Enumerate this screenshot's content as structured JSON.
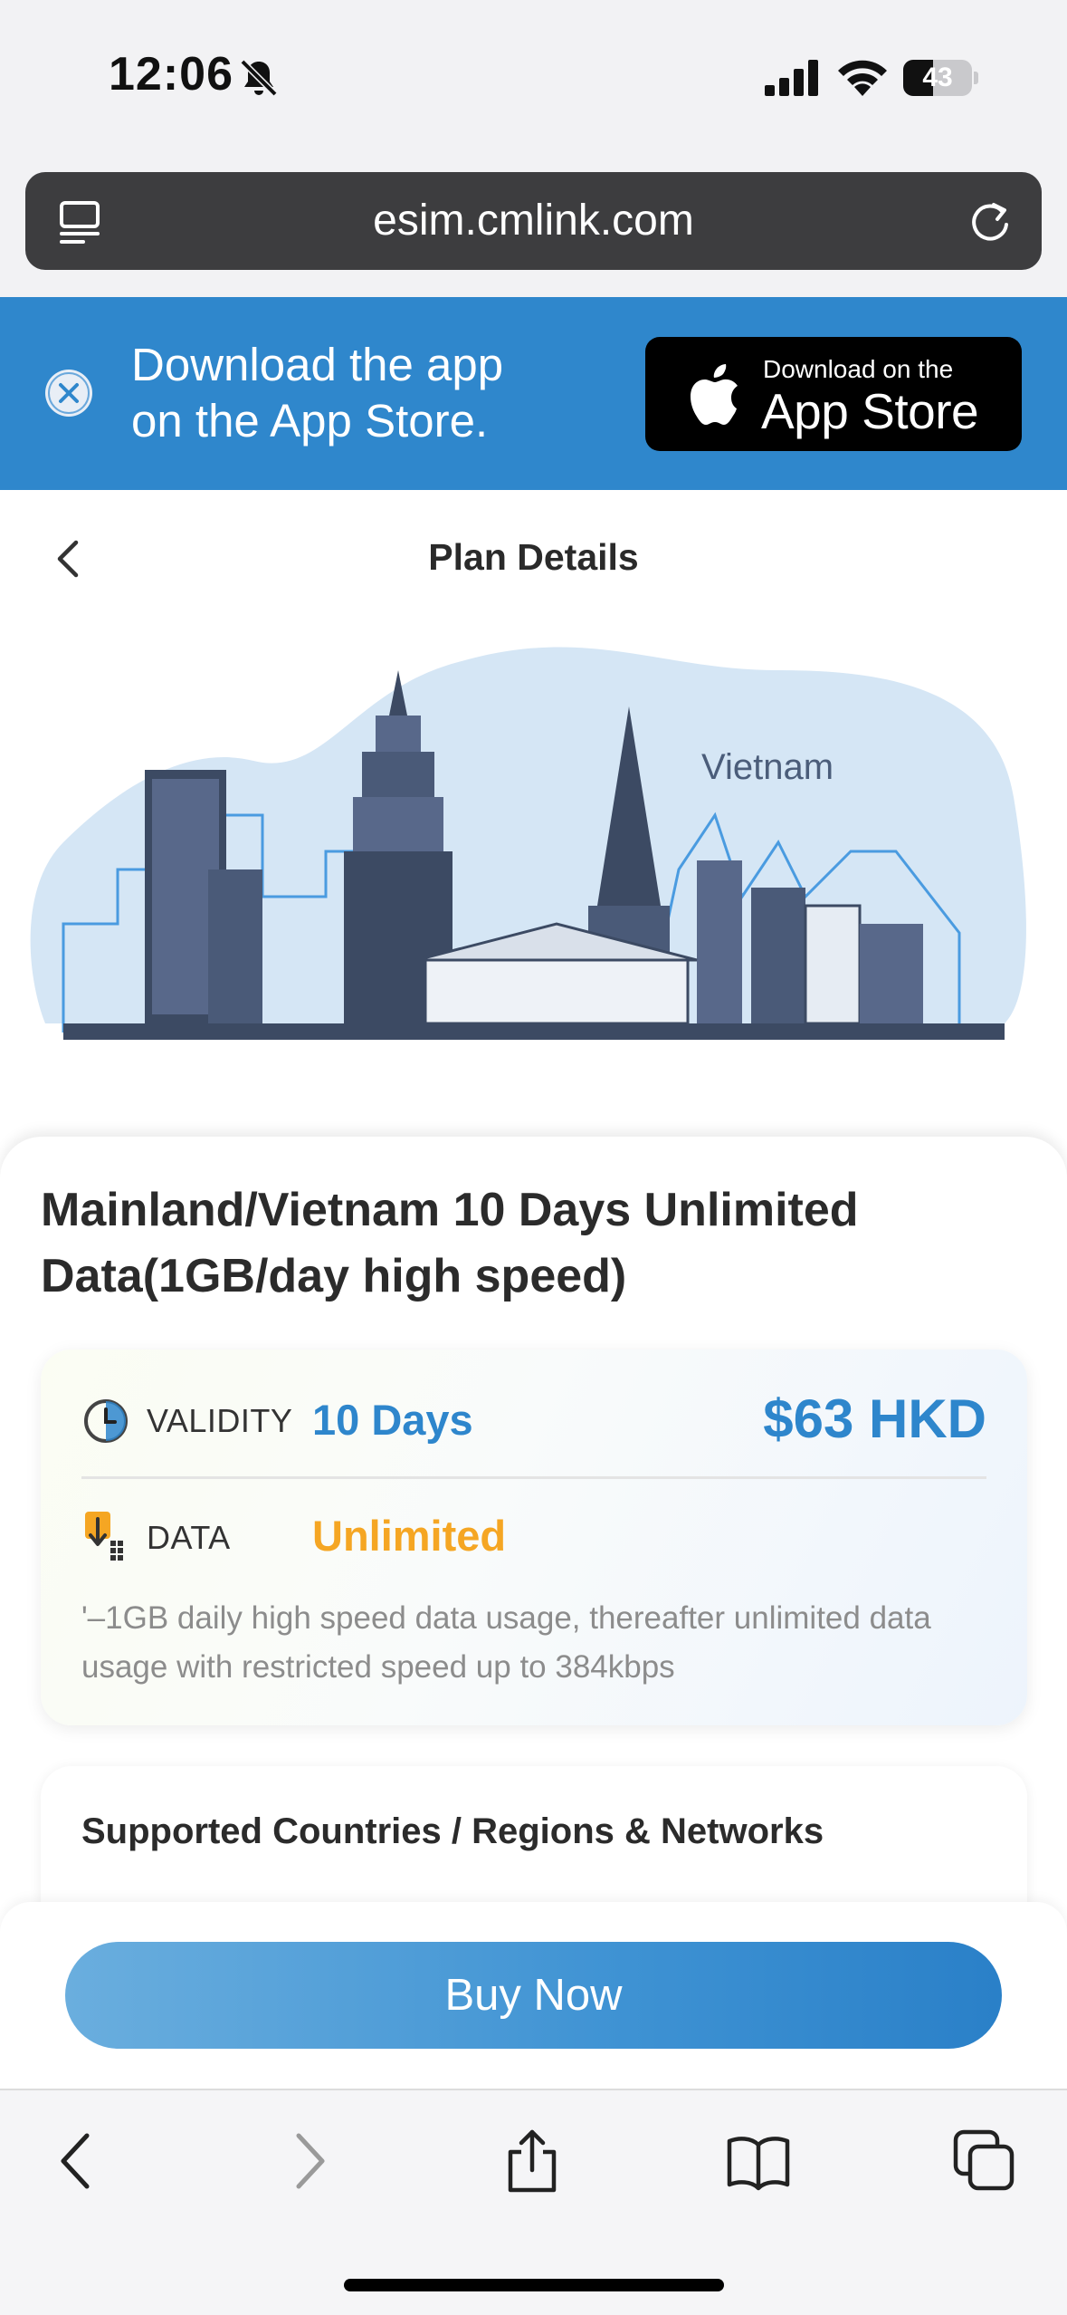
{
  "status_bar": {
    "time": "12:06",
    "battery_level": "43",
    "icons": [
      "bell-off-icon",
      "cellular-signal-icon",
      "wifi-icon",
      "battery-icon"
    ]
  },
  "browser": {
    "url": "esim.cmlink.com",
    "icons": [
      "reader-menu-icon",
      "reload-icon"
    ]
  },
  "app_banner": {
    "line1": "Download the app",
    "line2": "on the App Store.",
    "store_small": "Download on the",
    "store_big": "App Store",
    "bg_color": "#2f87cc"
  },
  "header": {
    "title": "Plan Details"
  },
  "hero": {
    "country_label": "Vietnam"
  },
  "plan": {
    "title_line1": "Mainland/Vietnam 10 Days Unlimited",
    "title_line2": "Data(1GB/day high speed)",
    "validity_label": "VALIDITY",
    "validity_value": "10 Days",
    "price": "$63 HKD",
    "data_label": "DATA",
    "data_value": "Unlimited",
    "description": "'–1GB daily high speed data usage, thereafter unlimited data usage with restricted speed up to 384kbps",
    "accent_color": "#2e86cc",
    "data_color": "#f5a623"
  },
  "countries": {
    "title": "Supported Countries / Regions & Networks"
  },
  "buy": {
    "label": "Buy Now"
  },
  "toolbar": {
    "icons": [
      "back-icon",
      "forward-icon",
      "share-icon",
      "bookmarks-icon",
      "tabs-icon"
    ]
  }
}
